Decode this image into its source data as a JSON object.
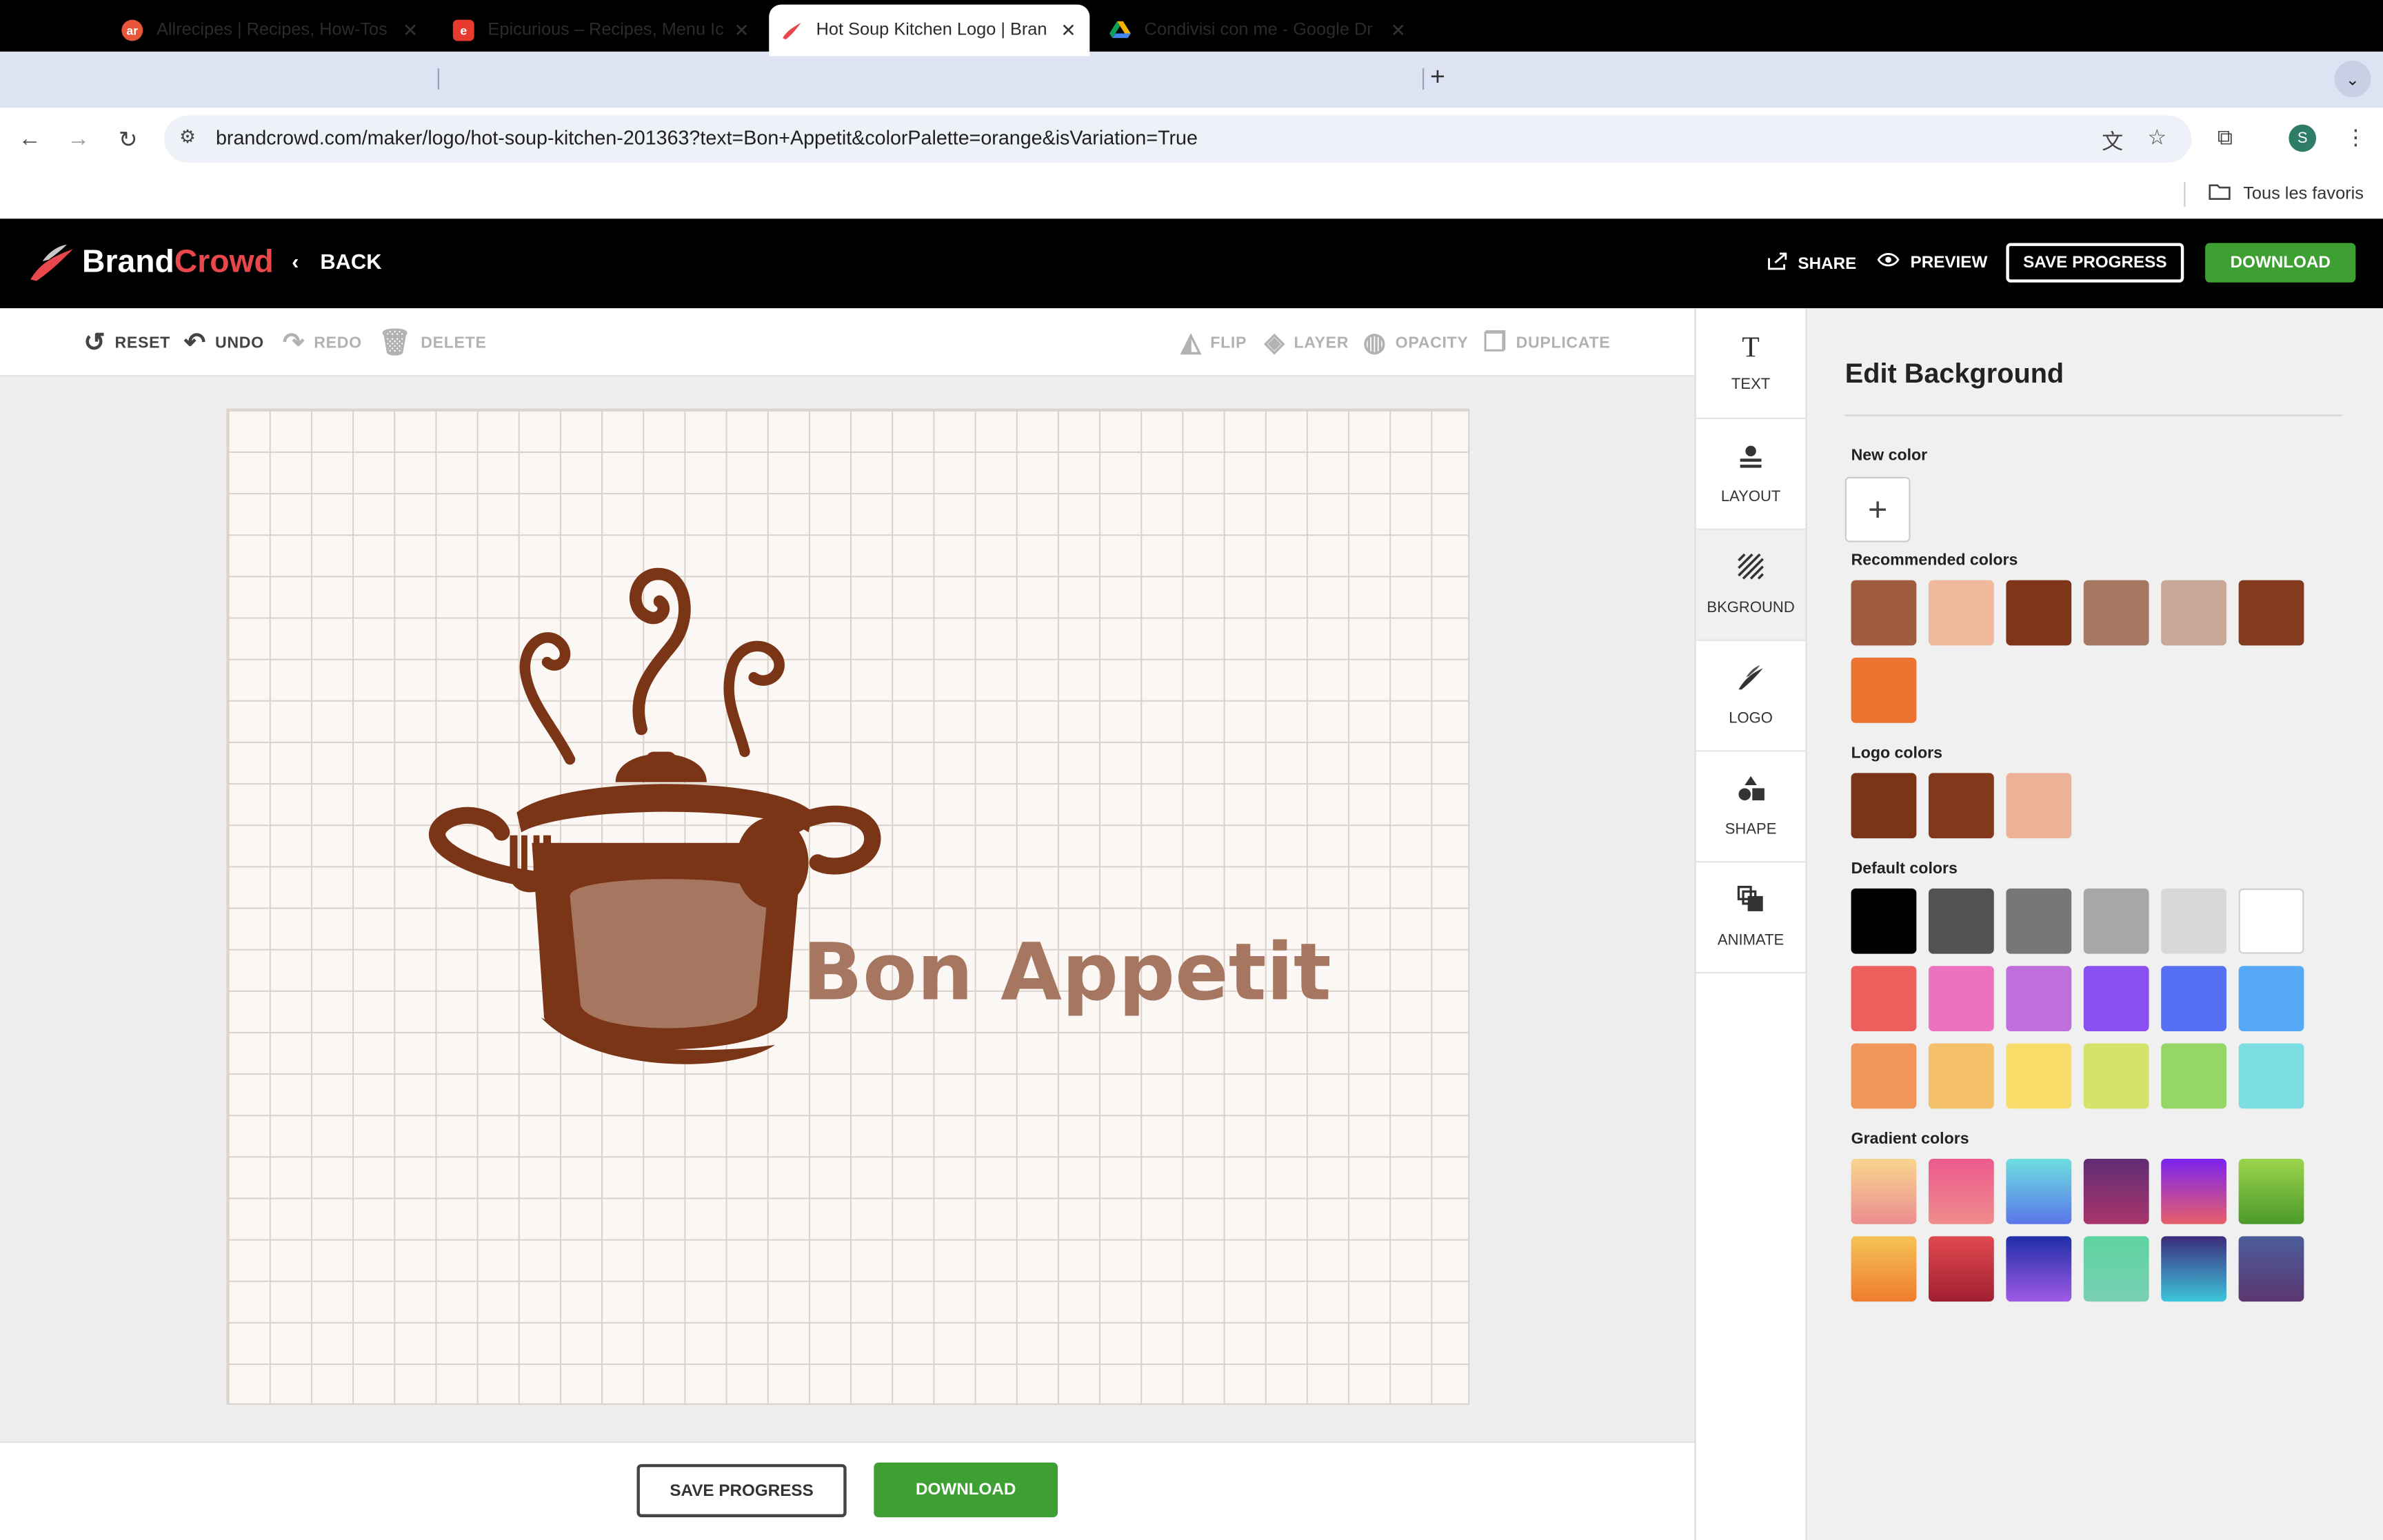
{
  "browser": {
    "tabs": [
      {
        "title": "Allrecipes | Recipes, How-Tos",
        "close": "✕",
        "favicon": "allrecipes-icon",
        "fav_text": "ar",
        "fav_color": "#e9553a"
      },
      {
        "title": "Epicurious – Recipes, Menu Ic",
        "close": "✕",
        "favicon": "epicurious-icon",
        "fav_text": "e",
        "fav_color": "#e63b2e"
      },
      {
        "title": "Hot Soup Kitchen Logo | Bran",
        "close": "✕",
        "favicon": "brandcrowd-icon",
        "fav_text": "",
        "fav_color": "#e8474c"
      },
      {
        "title": "Condivisi con me - Google Dr",
        "close": "✕",
        "favicon": "google-drive-icon",
        "fav_text": "",
        "fav_color": "#1ea362"
      }
    ],
    "new_tab": "+",
    "url": "brandcrowd.com/maker/logo/hot-soup-kitchen-201363?text=Bon+Appetit&colorPalette=orange&isVariation=True",
    "profile_initial": "S",
    "bookmarks_folder": "Tous les favoris"
  },
  "app": {
    "brand_part1": "Brand",
    "brand_part2": "Crowd",
    "back_label": "BACK",
    "share_label": "SHARE",
    "preview_label": "PREVIEW",
    "save_progress_label": "SAVE PROGRESS",
    "download_label": "DOWNLOAD"
  },
  "toolbar": {
    "reset": "RESET",
    "undo": "UNDO",
    "redo": "REDO",
    "delete": "DELETE",
    "flip": "FLIP",
    "layer": "LAYER",
    "opacity": "OPACITY",
    "duplicate": "DUPLICATE"
  },
  "canvas": {
    "logo_text": "Bon Appetit",
    "logo_dark": "#7a3416",
    "logo_light": "#a67660",
    "bg_color": "#fbf7f4"
  },
  "bottom": {
    "save_progress_label": "SAVE PROGRESS",
    "download_label": "DOWNLOAD"
  },
  "side_tabs": [
    {
      "label": "TEXT",
      "icon": "text-icon",
      "glyph": "T"
    },
    {
      "label": "LAYOUT",
      "icon": "layout-icon",
      "glyph": "≗"
    },
    {
      "label": "BKGROUND",
      "icon": "background-icon",
      "glyph": "▨"
    },
    {
      "label": "LOGO",
      "icon": "logo-icon",
      "glyph": "❥"
    },
    {
      "label": "SHAPE",
      "icon": "shape-icon",
      "glyph": "◆"
    },
    {
      "label": "ANIMATE",
      "icon": "animate-icon",
      "glyph": "❐"
    }
  ],
  "panel": {
    "title": "Edit Background",
    "new_color_label": "New color",
    "add_symbol": "+",
    "recommended_label": "Recommended colors",
    "recommended": [
      "#9f5c3f",
      "#f0b89d",
      "#7e3519",
      "#a67862",
      "#caa898",
      "#833a1d",
      "#ed7330"
    ],
    "logo_colors_label": "Logo colors",
    "logo_colors": [
      "#7a3416",
      "#83381b",
      "#ebb297"
    ],
    "default_label": "Default colors",
    "default_colors": [
      "#000000",
      "#535353",
      "#777777",
      "#a8a8a8",
      "#d8d8d8",
      "#ffffff",
      "#ec5f5d",
      "#ec72c1",
      "#bf6fdd",
      "#8b4ff0",
      "#5570f2",
      "#56aaf5",
      "#f1955a",
      "#f4c06a",
      "#f7dc6a",
      "#d4e36a",
      "#94d766",
      "#7cdde3"
    ],
    "gradient_label": "Gradient colors",
    "gradient_colors": [
      [
        "#f7d58e",
        "#ec8d91"
      ],
      [
        "#ed5a8e",
        "#ef8c8c"
      ],
      [
        "#6ddfe0",
        "#5a76e9"
      ],
      [
        "#612c74",
        "#a8356b"
      ],
      [
        "#7b23ef",
        "#e8606a"
      ],
      [
        "#9bd44b",
        "#4c9a2c"
      ],
      [
        "#f6c256",
        "#ef7d2e"
      ],
      [
        "#e04a4f",
        "#a01f32"
      ],
      [
        "#1f2ea8",
        "#a05ae6"
      ],
      [
        "#5dd4a0",
        "#79cfb4"
      ],
      [
        "#3b2b7c",
        "#3dc6dc"
      ],
      [
        "#4b5d9a",
        "#5b3670"
      ]
    ]
  }
}
